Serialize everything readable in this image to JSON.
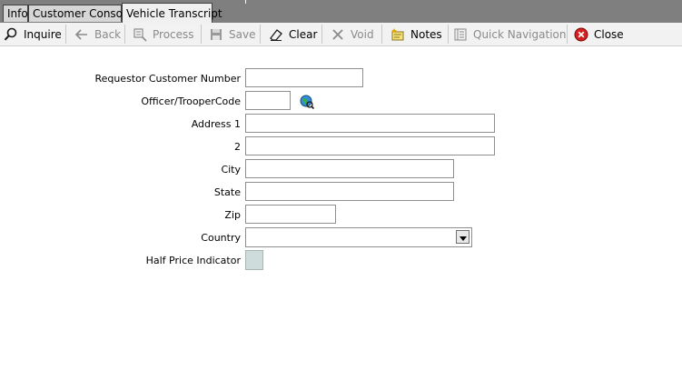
{
  "tabs": [
    {
      "label": "Info"
    },
    {
      "label": "Customer Console"
    },
    {
      "label": "Vehicle Transcript"
    }
  ],
  "toolbar": {
    "inquire": "Inquire",
    "back": "Back",
    "process": "Process",
    "save": "Save",
    "clear": "Clear",
    "void": "Void",
    "notes": "Notes",
    "quick_navigation": "Quick Navigation",
    "close": "Close"
  },
  "form": {
    "requestor_customer_number": {
      "label": "Requestor Customer Number",
      "value": ""
    },
    "officer_trooper_code": {
      "label": "Officer/TrooperCode",
      "value": ""
    },
    "address1": {
      "label": "Address 1",
      "value": ""
    },
    "address2": {
      "label": "2",
      "value": ""
    },
    "city": {
      "label": "City",
      "value": ""
    },
    "state": {
      "label": "State",
      "value": ""
    },
    "zip": {
      "label": "Zip",
      "value": ""
    },
    "country": {
      "label": "Country",
      "value": ""
    },
    "half_price_indicator": {
      "label": "Half Price Indicator",
      "checked": false
    }
  },
  "colors": {
    "tabstrip_bg": "#7f7f7f",
    "toolbar_bg": "#f2f2f2",
    "disabled_text": "#8a8a8a",
    "close_red": "#d62020"
  },
  "icons": [
    "magnifier-icon",
    "back-arrow-icon",
    "process-icon",
    "save-disk-icon",
    "eraser-icon",
    "void-x-icon",
    "notes-icon",
    "quick-navigation-icon",
    "close-circle-icon",
    "lookup-globe-icon",
    "dropdown-arrow-icon"
  ]
}
